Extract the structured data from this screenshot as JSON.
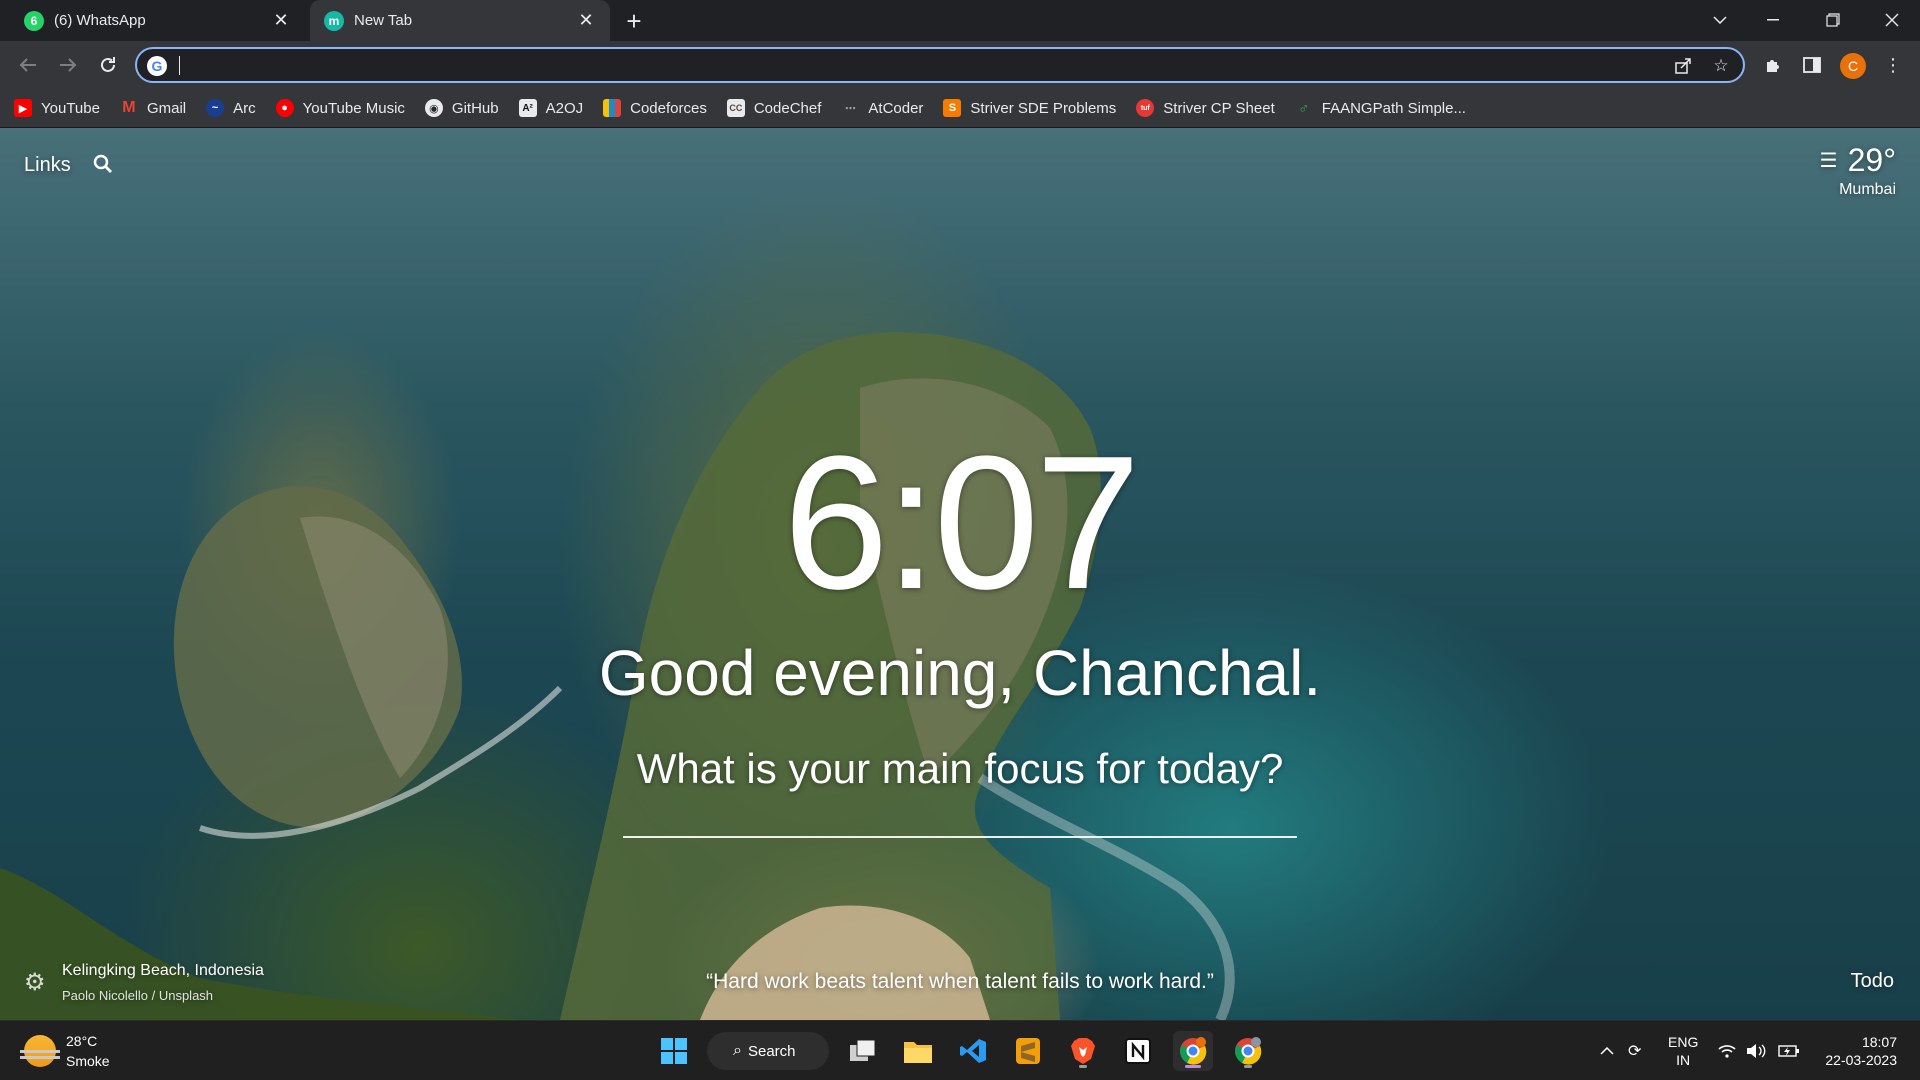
{
  "browser": {
    "tabs": [
      {
        "title": "(6) WhatsApp",
        "icon": "whatsapp-icon",
        "color": "#25d366",
        "glyph": "6",
        "active": false
      },
      {
        "title": "New Tab",
        "icon": "momentum-icon",
        "color": "#17b8a6",
        "glyph": "m",
        "active": true
      }
    ],
    "omnibox": {
      "value": "",
      "placeholder": ""
    },
    "profile_initial": "C"
  },
  "bookmarks": [
    {
      "label": "YouTube",
      "icon": "youtube-icon",
      "color": "#ff0000",
      "glyph": "▶"
    },
    {
      "label": "Gmail",
      "icon": "gmail-icon",
      "color": "#ea4335",
      "glyph": "M"
    },
    {
      "label": "Arc",
      "icon": "arc-icon",
      "color": "#1a73e8",
      "glyph": "~"
    },
    {
      "label": "YouTube Music",
      "icon": "youtube-music-icon",
      "color": "#ff0000",
      "glyph": "●"
    },
    {
      "label": "GitHub",
      "icon": "github-icon",
      "color": "#24292e",
      "glyph": "◉"
    },
    {
      "label": "A2OJ",
      "icon": "a2oj-icon",
      "color": "#111111",
      "glyph": "A²"
    },
    {
      "label": "Codeforces",
      "icon": "codeforces-icon",
      "color": "#1f8acb",
      "glyph": "▮"
    },
    {
      "label": "CodeChef",
      "icon": "codechef-icon",
      "color": "#5b4638",
      "glyph": "CC"
    },
    {
      "label": "AtCoder",
      "icon": "atcoder-icon",
      "color": "#35363a",
      "glyph": "⋯"
    },
    {
      "label": "Striver SDE Problems",
      "icon": "striver-sde-icon",
      "color": "#f57c00",
      "glyph": "S"
    },
    {
      "label": "Striver CP Sheet",
      "icon": "striver-cp-icon",
      "color": "#e53935",
      "glyph": "tuf"
    },
    {
      "label": "FAANGPath Simple...",
      "icon": "faangpath-icon",
      "color": "#35363a",
      "glyph": "♂"
    }
  ],
  "momentum": {
    "links_label": "Links",
    "weather": {
      "temp": "29°",
      "city": "Mumbai"
    },
    "time": "6:07",
    "greeting": "Good evening, Chanchal.",
    "focus_question": "What is your main focus for today?",
    "focus_value": "",
    "quote": "“Hard work beats talent when talent fails to work hard.”",
    "photo_location": "Kelingking Beach, Indonesia",
    "photo_credit": "Paolo Nicolello / Unsplash",
    "todo_label": "Todo"
  },
  "taskbar": {
    "weather_temp": "28°C",
    "weather_condition": "Smoke",
    "search_label": "Search",
    "language": "ENG",
    "region": "IN",
    "time": "18:07",
    "date": "22-03-2023"
  },
  "colors": {
    "accent": "#8ab4f8",
    "chrome_dark": "#202124",
    "chrome_toolbar": "#35363a",
    "profile": "#e8710a"
  }
}
